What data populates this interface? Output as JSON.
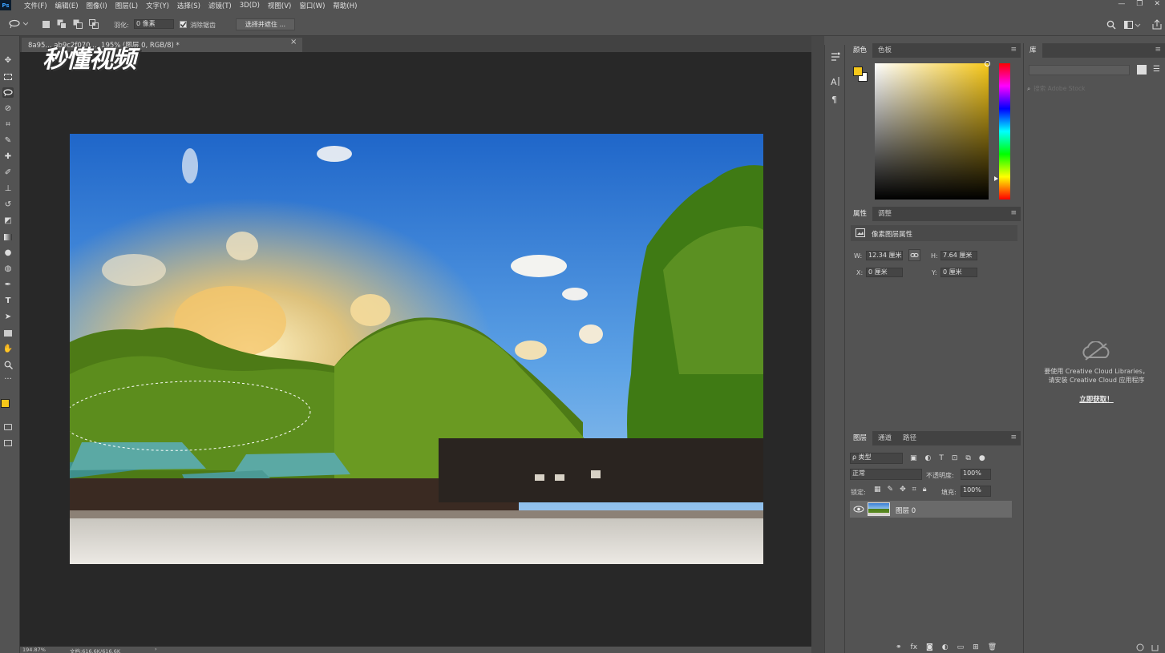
{
  "app": {
    "logo": "Ps"
  },
  "menu": [
    "文件(F)",
    "编辑(E)",
    "图像(I)",
    "图层(L)",
    "文字(Y)",
    "选择(S)",
    "滤镜(T)",
    "3D(D)",
    "视图(V)",
    "窗口(W)",
    "帮助(H)"
  ],
  "window_controls": {
    "minimize": "—",
    "restore": "❐",
    "close": "✕"
  },
  "options": {
    "feather_label": "羽化:",
    "feather_value": "0 像素",
    "antialias_label": "消除锯齿",
    "antialias_checked": true,
    "select_mask_button": "选择并遮住 ..."
  },
  "document": {
    "tab_title": "8a95... ab9c2f070 ... 195% (图层 0, RGB/8) *",
    "tab_close": "×",
    "watermark": "秒懂视频"
  },
  "status": {
    "zoom": "194.87%",
    "doc_info": "文档:616.6K/616.6K",
    "arrow": "›"
  },
  "color_panel": {
    "tabs": [
      "颜色",
      "色板"
    ],
    "fg_color": "#f7c81a",
    "bg_color": "#ffffff"
  },
  "properties_panel": {
    "tabs": [
      "属性",
      "调整"
    ],
    "title": "像素图层属性",
    "w_label": "W:",
    "w_value": "12.34 厘米",
    "h_label": "H:",
    "h_value": "7.64 厘米",
    "x_label": "X:",
    "x_value": "0 厘米",
    "y_label": "Y:",
    "y_value": "0 厘米"
  },
  "layers_panel": {
    "tabs": [
      "图层",
      "通道",
      "路径"
    ],
    "filter_kind": "ρ 类型",
    "blend_mode": "正常",
    "opacity_label": "不透明度:",
    "opacity_value": "100%",
    "lock_label": "锁定:",
    "fill_label": "填充:",
    "fill_value": "100%",
    "layers": [
      {
        "name": "图层 0",
        "visible": true
      }
    ]
  },
  "libraries_panel": {
    "tab": "库",
    "search_placeholder": "搜索 Adobe Stock",
    "message_line1": "要使用 Creative Cloud Libraries，",
    "message_line2": "请安装 Creative Cloud 应用程序",
    "link": "立即获取！"
  }
}
